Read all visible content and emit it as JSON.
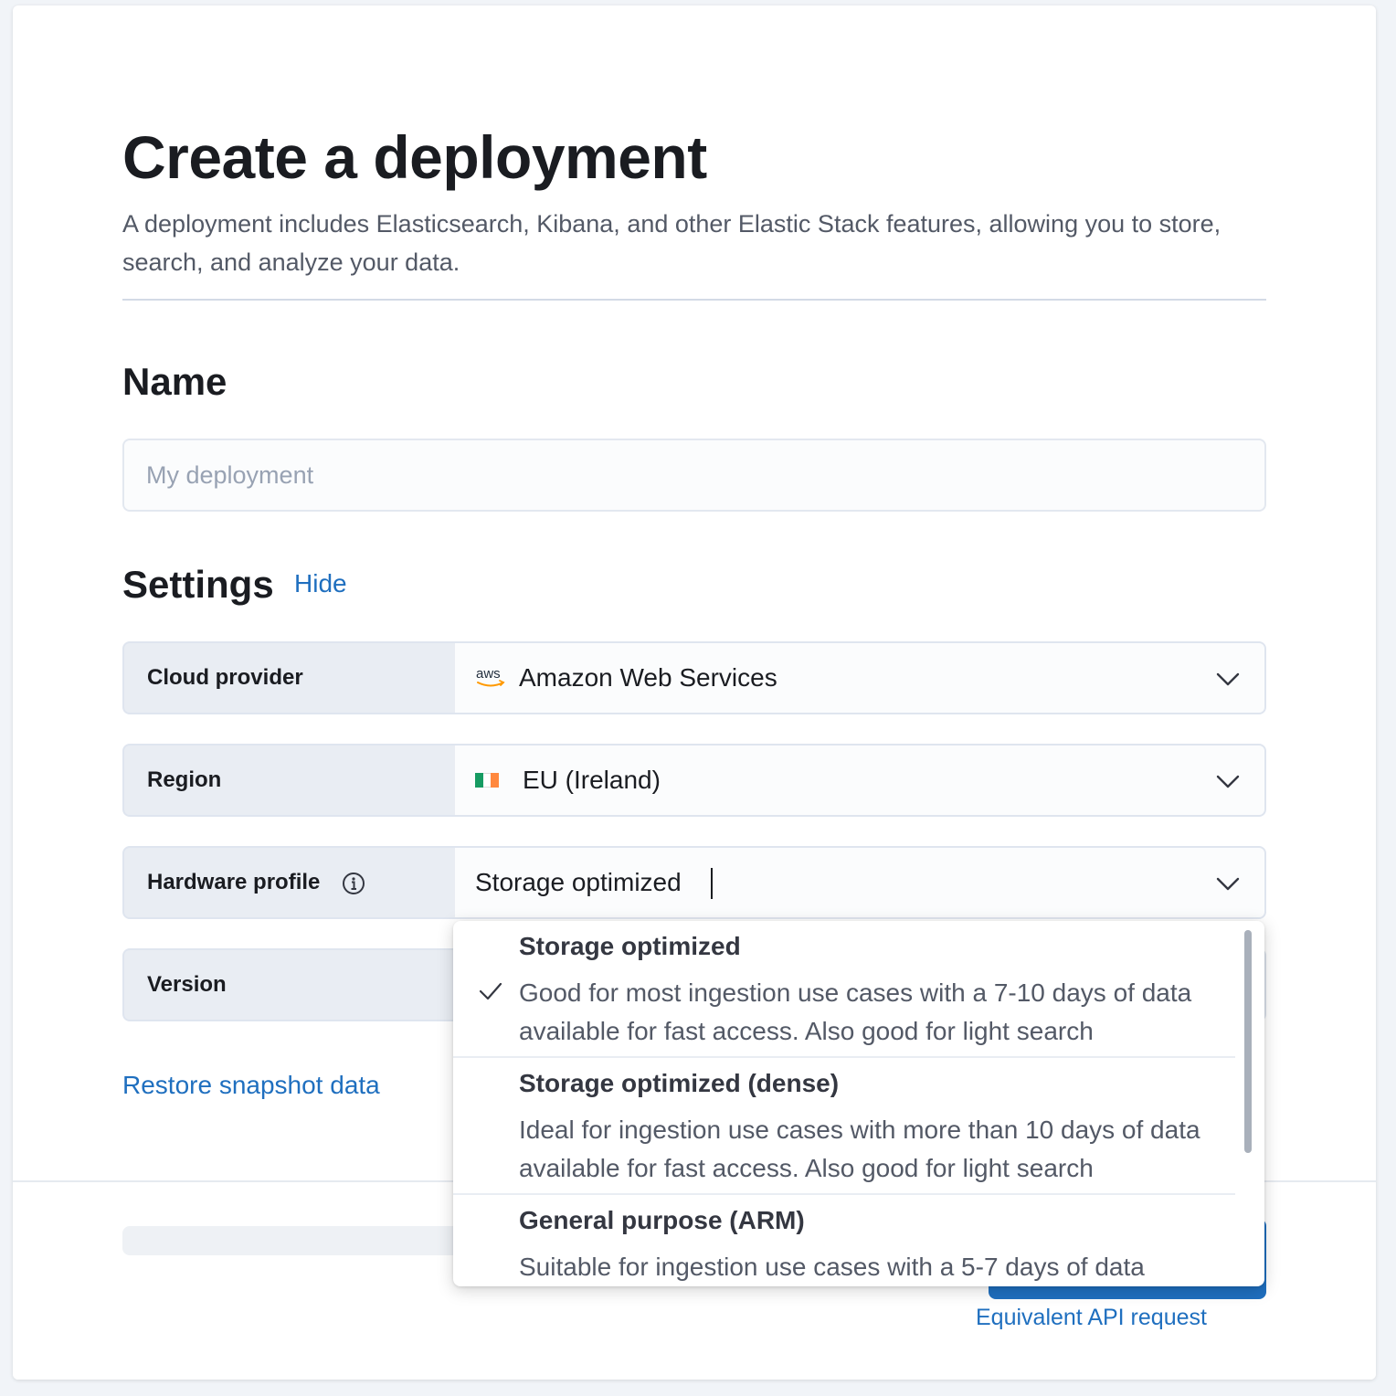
{
  "page": {
    "title": "Create a deployment",
    "description": "A deployment includes Elasticsearch, Kibana, and other Elastic Stack features, allowing you to store, search, and analyze your data."
  },
  "name_section": {
    "title": "Name",
    "input_placeholder": "My deployment",
    "input_value": ""
  },
  "settings": {
    "title": "Settings",
    "hide_label": "Hide",
    "cloud_provider": {
      "label": "Cloud provider",
      "value": "Amazon Web Services",
      "icon": "aws-logo-icon"
    },
    "region": {
      "label": "Region",
      "value": "EU (Ireland)",
      "icon": "ireland-flag-icon",
      "flag_colors": [
        "#169b62",
        "#ffffff",
        "#ff883e"
      ]
    },
    "hardware_profile": {
      "label": "Hardware profile",
      "value": "Storage optimized",
      "icon": "info-icon"
    },
    "version": {
      "label": "Version"
    }
  },
  "restore_label": "Restore snapshot data",
  "api_label": "Equivalent API request",
  "dropdown": {
    "options": [
      {
        "title": "Storage optimized",
        "description": "Good for most ingestion use cases with a 7-10 days of data available for fast access. Also good for light search",
        "selected": true
      },
      {
        "title": "Storage optimized (dense)",
        "description": "Ideal for ingestion use cases with more than 10 days of data available for fast access. Also good for light search",
        "selected": false
      },
      {
        "title": "General purpose (ARM)",
        "description": "Suitable for ingestion use cases with a 5-7 days of data",
        "selected": false
      }
    ]
  },
  "colors": {
    "link": "#1f6fbf",
    "label_bg": "#e9edf3",
    "text_primary": "#1a1c21",
    "text_secondary": "#535966"
  }
}
